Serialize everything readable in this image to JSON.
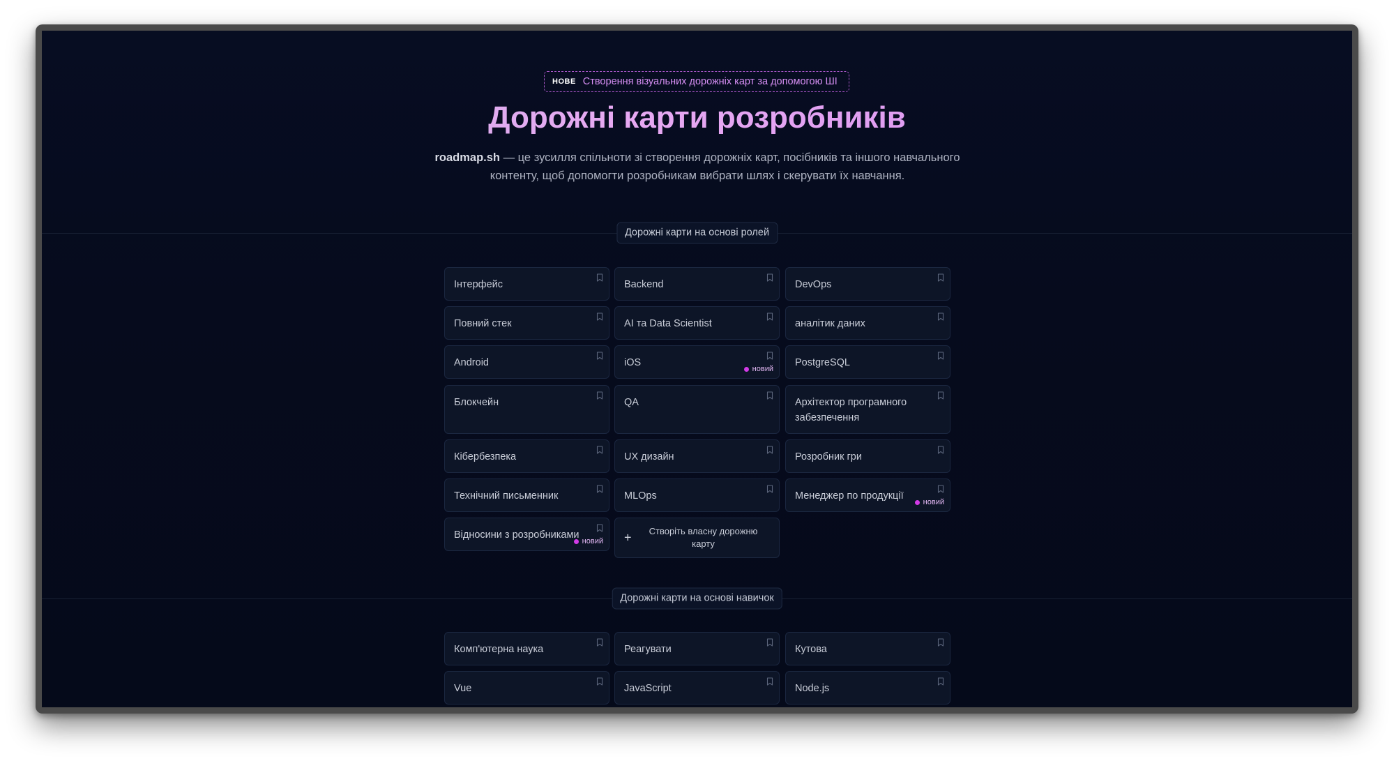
{
  "hero": {
    "badge_tag": "НОВЕ",
    "badge_text": "Створення візуальних дорожніх карт за допомогою ШІ",
    "title": "Дорожні карти розробників",
    "desc_brand": "roadmap.sh",
    "desc_text": " — це зусилля спільноти зі створення дорожніх карт, посібників та іншого навчального контенту, щоб допомогти розробникам вибрати шлях і скерувати їх навчання."
  },
  "role_section": {
    "label": "Дорожні карти на основі ролей",
    "items": [
      {
        "label": "Інтерфейс"
      },
      {
        "label": "Backend"
      },
      {
        "label": "DevOps"
      },
      {
        "label": "Повний стек"
      },
      {
        "label": "AI та Data Scientist"
      },
      {
        "label": "аналітик даних"
      },
      {
        "label": "Android"
      },
      {
        "label": "iOS",
        "badge": "новий"
      },
      {
        "label": "PostgreSQL"
      },
      {
        "label": "Блокчейн"
      },
      {
        "label": "QA"
      },
      {
        "label": "Архітектор програмного забезпечення"
      },
      {
        "label": "Кібербезпека"
      },
      {
        "label": "UX дизайн"
      },
      {
        "label": "Розробник гри"
      },
      {
        "label": "Технічний письменник"
      },
      {
        "label": "MLOps"
      },
      {
        "label": "Менеджер по продукції",
        "badge": "новий"
      },
      {
        "label": "Відносини з розробниками",
        "badge": "новий"
      }
    ],
    "create_label": "Створіть власну дорожню карту",
    "create_icon": "plus-icon"
  },
  "skill_section": {
    "label": "Дорожні карти на основі навичок",
    "items": [
      {
        "label": "Комп'ютерна наука"
      },
      {
        "label": "Реагувати"
      },
      {
        "label": "Кутова"
      },
      {
        "label": "Vue"
      },
      {
        "label": "JavaScript"
      },
      {
        "label": "Node.js"
      }
    ]
  },
  "icons": {
    "bookmark": "bookmark-icon",
    "new_dot": "new-dot-icon"
  },
  "colors": {
    "background": "#060b1d",
    "card": "#0d1527",
    "accent": "#d23be6",
    "title_gradient_start": "#c9b3e6",
    "title_gradient_end": "#d58cf0"
  }
}
